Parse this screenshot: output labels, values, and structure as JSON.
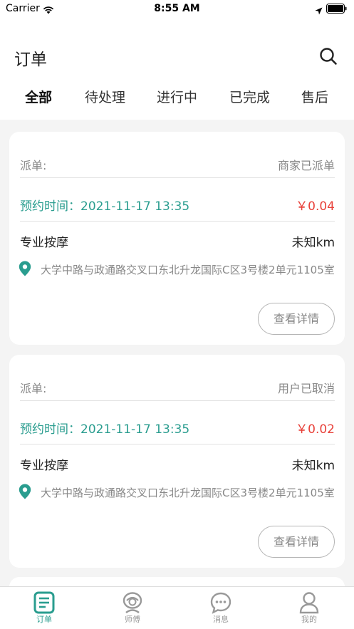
{
  "status_bar": {
    "carrier": "Carrier",
    "time": "8:55 AM"
  },
  "header": {
    "title": "订单"
  },
  "tabs": [
    {
      "label": "全部",
      "active": true
    },
    {
      "label": "待处理",
      "active": false
    },
    {
      "label": "进行中",
      "active": false
    },
    {
      "label": "已完成",
      "active": false
    },
    {
      "label": "售后",
      "active": false
    }
  ],
  "orders": [
    {
      "dispatch_label": "派单:",
      "status": "商家已派单",
      "appointment": "预约时间：2021-11-17 13:35",
      "price": "￥0.04",
      "service": "专业按摩",
      "distance": "未知km",
      "address": "大学中路与政通路交叉口东北升龙国际C区3号楼2单元1105室",
      "detail_button": "查看详情"
    },
    {
      "dispatch_label": "派单:",
      "status": "用户已取消",
      "appointment": "预约时间：2021-11-17 13:35",
      "price": "￥0.02",
      "service": "专业按摩",
      "distance": "未知km",
      "address": "大学中路与政通路交叉口东北升龙国际C区3号楼2单元1105室",
      "detail_button": "查看详情"
    }
  ],
  "tabbar": [
    {
      "label": "订单",
      "icon": "order-icon",
      "active": true
    },
    {
      "label": "师傅",
      "icon": "master-icon",
      "active": false
    },
    {
      "label": "消息",
      "icon": "message-icon",
      "active": false
    },
    {
      "label": "我的",
      "icon": "profile-icon",
      "active": false
    }
  ],
  "colors": {
    "accent": "#2a9d8f",
    "price": "#e8413a",
    "background": "#f4f4f4"
  }
}
